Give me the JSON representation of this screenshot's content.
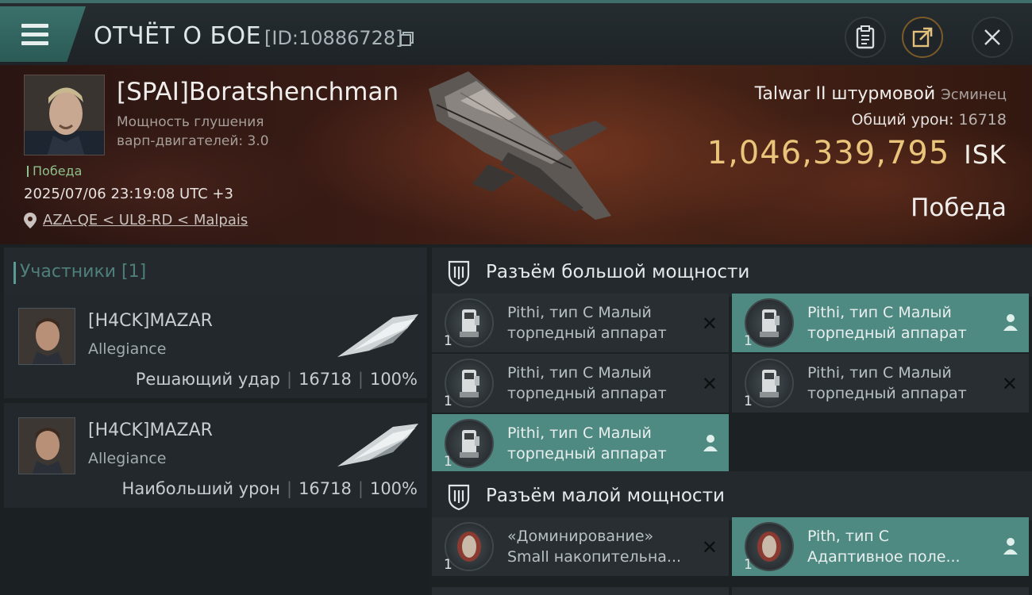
{
  "header": {
    "title": "ОТЧЁТ О БОЕ",
    "battle_id": "[ID:10886728]"
  },
  "victim": {
    "name": "[SPAI]Boratshenchman",
    "stat_line1": "Мощность глушения",
    "stat_line2": "варп-двигателей: 3.0",
    "result_small": "Победа",
    "timestamp": "2025/07/06 23:19:08 UTC +3",
    "location": "AZA-QE < UL8-RD < Malpais",
    "ship_name": "Talwar II штурмовой",
    "ship_class": "Эсминец",
    "total_damage_label": "Общий урон:",
    "total_damage": "16718",
    "isk_value": "1,046,339,795",
    "isk_currency": "ISK",
    "result_big": "Победа"
  },
  "participants": {
    "header": "Участники [1]",
    "items": [
      {
        "name": "[H4CK]MAZAR",
        "ship": "Allegiance",
        "label": "Решающий удар",
        "damage": "16718",
        "percent": "100%"
      },
      {
        "name": "[H4CK]MAZAR",
        "ship": "Allegiance",
        "label": "Наибольший урон",
        "damage": "16718",
        "percent": "100%"
      }
    ]
  },
  "fittings": {
    "high_slots_title": "Разъём большой мощности",
    "low_slots_title": "Разъём малой мощности",
    "high": [
      {
        "qty": "1",
        "line1": "Pithi, тип C Малый",
        "line2": "торпедный аппарат",
        "state": "destroyed"
      },
      {
        "qty": "1",
        "line1": "Pithi, тип C Малый",
        "line2": "торпедный аппарат",
        "state": "dropped"
      },
      {
        "qty": "1",
        "line1": "Pithi, тип C Малый",
        "line2": "торпедный аппарат",
        "state": "destroyed"
      },
      {
        "qty": "1",
        "line1": "Pithi, тип C Малый",
        "line2": "торпедный аппарат",
        "state": "destroyed"
      },
      {
        "qty": "1",
        "line1": "Pithi, тип C Малый",
        "line2": "торпедный аппарат",
        "state": "dropped"
      }
    ],
    "low": [
      {
        "qty": "1",
        "line1": "«Доминирование»",
        "line2": "Small накопительна...",
        "state": "destroyed"
      },
      {
        "qty": "1",
        "line1": "Pith, тип C",
        "line2": "Адаптивное поле...",
        "state": "dropped"
      }
    ]
  },
  "colors": {
    "accent_teal": "#4f8a82",
    "isk_gold": "#e9c47a",
    "victory_green": "#8fbf8a"
  },
  "icons": [
    "menu-icon",
    "copy-icon",
    "clipboard-icon",
    "share-icon",
    "close-icon",
    "location-pin-icon",
    "slot-high-icon",
    "slot-low-icon",
    "destroyed-x-icon",
    "dropped-person-icon"
  ]
}
